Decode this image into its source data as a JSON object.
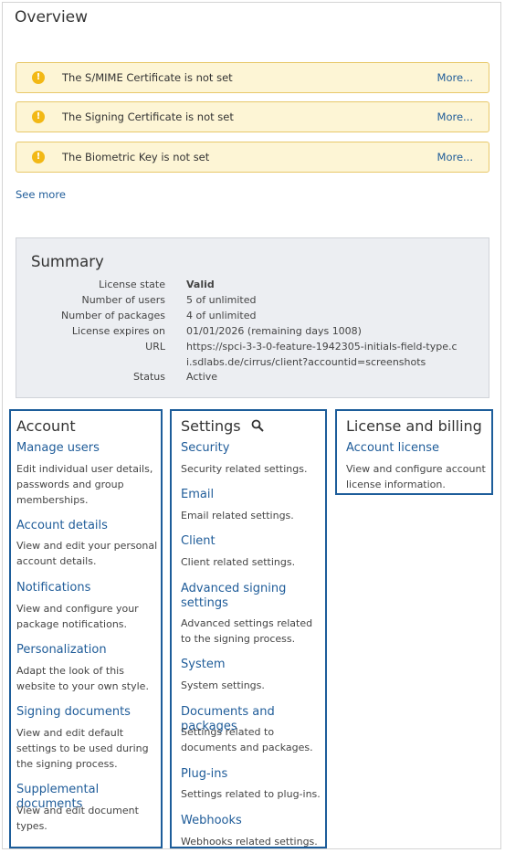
{
  "page": {
    "title": "Overview"
  },
  "alerts": [
    {
      "message": "The S/MIME Certificate is not set",
      "more": "More..."
    },
    {
      "message": "The Signing Certificate is not set",
      "more": "More..."
    },
    {
      "message": "The Biometric Key is not set",
      "more": "More..."
    }
  ],
  "alert_icon": "!",
  "see_more": "See more",
  "summary": {
    "title": "Summary",
    "rows": [
      {
        "label": "License state",
        "value": "Valid"
      },
      {
        "label": "Number of users",
        "value": "5 of unlimited"
      },
      {
        "label": "Number of packages",
        "value": "4 of unlimited"
      },
      {
        "label": "License expires on",
        "value": "01/01/2026 (remaining days 1008)"
      },
      {
        "label": "URL",
        "value": "https://spci-3-3-0-feature-1942305-initials-field-type.ci.sdlabs.de/cirrus/client?accountid=screenshots"
      },
      {
        "label": "Status",
        "value": "Active"
      }
    ]
  },
  "account": {
    "title": "Account",
    "items": [
      {
        "link": "Manage users",
        "desc": "Edit individual user details, passwords and group memberships."
      },
      {
        "link": "Account details",
        "desc": "View and edit your personal account details."
      },
      {
        "link": "Notifications",
        "desc": "View and configure your package notifications."
      },
      {
        "link": "Personalization",
        "desc": "Adapt the look of this website to your own style."
      },
      {
        "link": "Signing documents",
        "desc": "View and edit default settings to be used during the signing process."
      },
      {
        "link": "Supplemental documents",
        "desc": "View and edit document types."
      }
    ]
  },
  "settings": {
    "title": "Settings",
    "items": [
      {
        "link": "Security",
        "desc": "Security related settings."
      },
      {
        "link": "Email",
        "desc": "Email related settings."
      },
      {
        "link": "Client",
        "desc": "Client related settings."
      },
      {
        "link": "Advanced signing settings",
        "desc": "Advanced settings related to the signing process."
      },
      {
        "link": "System",
        "desc": "System settings."
      },
      {
        "link": "Documents and packages",
        "desc": "Settings related to documents and packages."
      },
      {
        "link": "Plug-ins",
        "desc": "Settings related to plug-ins."
      },
      {
        "link": "Webhooks",
        "desc": "Webhooks related settings."
      }
    ]
  },
  "license": {
    "title": "License and billing",
    "items": [
      {
        "link": "Account license",
        "desc": "View and configure account license information."
      }
    ]
  }
}
